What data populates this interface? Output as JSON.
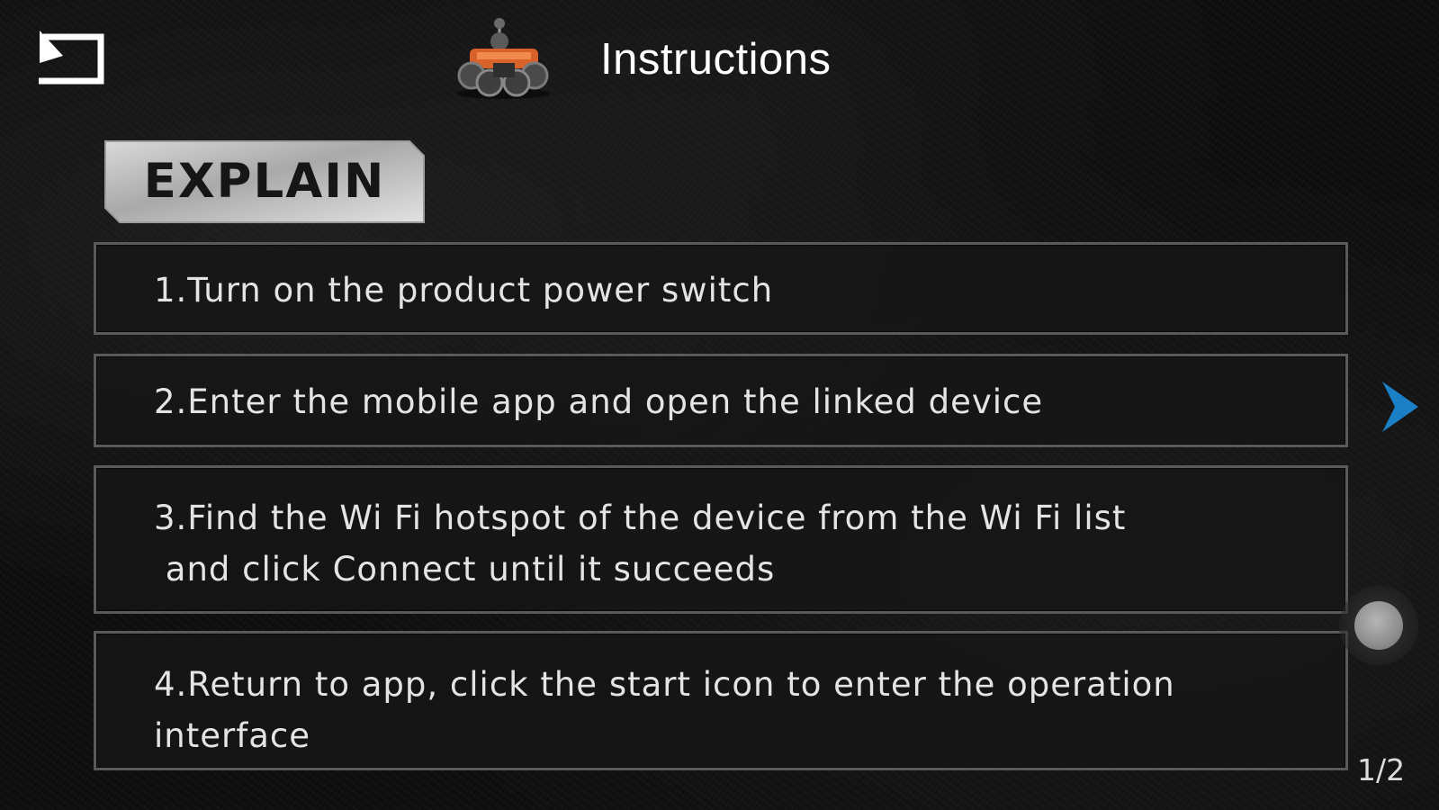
{
  "header": {
    "title": "Instructions",
    "back_icon": "back-arrow-icon",
    "logo_icon": "drone-icon"
  },
  "badge": {
    "label": "EXPLAIN"
  },
  "steps": [
    {
      "text": "1.Turn on the product power switch"
    },
    {
      "text": "2.Enter the mobile app and open the linked device"
    },
    {
      "text": "3.Find the Wi Fi hotspot of the device from the Wi Fi list\n and click Connect until it succeeds"
    },
    {
      "text": "4.Return to app, click the start icon to enter the operation\ninterface"
    }
  ],
  "navigation": {
    "next_icon": "chevron-right-icon",
    "page_indicator": "1/2"
  },
  "colors": {
    "accent_arrow": "#1a7fc4",
    "text": "#e4e4e4",
    "badge_text": "#161616"
  }
}
